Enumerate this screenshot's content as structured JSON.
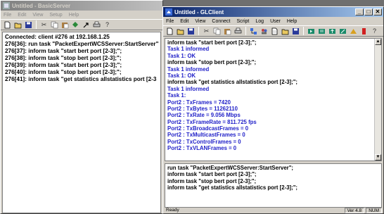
{
  "server": {
    "title": "Untitled - BasicServer",
    "menu": [
      "File",
      "Edit",
      "View",
      "Setup",
      "Help"
    ],
    "log": [
      "Connected: client #276 at 192.168.1.25",
      "276[36]: run task \"PacketExpertWCSServer:StartServer\"",
      "276[37]: inform task \"start bert port [2-3];\";",
      "276[38]: inform task \"stop bert port [2-3];\";",
      "276[39]: inform task \"start bert port [2-3];\";",
      "276[40]: inform task \"stop bert port [2-3];\";",
      "276[41]: inform task \"get statistics allstatistics  port [2-3"
    ]
  },
  "client": {
    "title": "Untitled - GLClient",
    "menu": [
      "File",
      "Edit",
      "View",
      "Connect",
      "Script",
      "Log",
      "User",
      "Help"
    ],
    "output": [
      {
        "text": "inform task \"start bert port [2-3];\";",
        "color": "#000000"
      },
      {
        "text": "Task 1 informed",
        "color": "#1f1fc8"
      },
      {
        "text": "Task 1: OK",
        "color": "#1f1fc8"
      },
      {
        "text": "inform task \"stop bert port [2-3];\";",
        "color": "#000000"
      },
      {
        "text": "Task 1 informed",
        "color": "#1f1fc8"
      },
      {
        "text": "Task 1: OK",
        "color": "#1f1fc8"
      },
      {
        "text": "inform task \"get statistics allstatistics  port [2-3];\";",
        "color": "#000000"
      },
      {
        "text": "Task 1 informed",
        "color": "#1f1fc8"
      },
      {
        "text": "Task 1:",
        "color": "#1f1fc8"
      },
      {
        "text": "Port2 : TxFrames = 7420",
        "color": "#1f1fc8"
      },
      {
        "text": "Port2 : TxBytes = 11262110",
        "color": "#1f1fc8"
      },
      {
        "text": "Port2 : TxRate = 9.056 Mbps",
        "color": "#1f1fc8"
      },
      {
        "text": "Port2 : TxFrameRate = 811.725 fps",
        "color": "#1f1fc8"
      },
      {
        "text": "Port2 : TxBroadcastFrames = 0",
        "color": "#1f1fc8"
      },
      {
        "text": "Port2 : TxMulticastFrames = 0",
        "color": "#1f1fc8"
      },
      {
        "text": "Port2 : TxControlFrames = 0",
        "color": "#1f1fc8"
      },
      {
        "text": "Port2 : TxVLANFrames = 0",
        "color": "#1f1fc8"
      }
    ],
    "input": [
      "run task \"PacketExpertWCSServer:StartServer\";",
      "inform task \"start bert port [2-3];\";",
      "inform task \"stop bert port [2-3];\";",
      "inform task \"get statistics allstatistics  port [2-3];\";"
    ],
    "status": {
      "message": "Ready",
      "version": "Ver 4.8",
      "num": "NUM"
    }
  }
}
